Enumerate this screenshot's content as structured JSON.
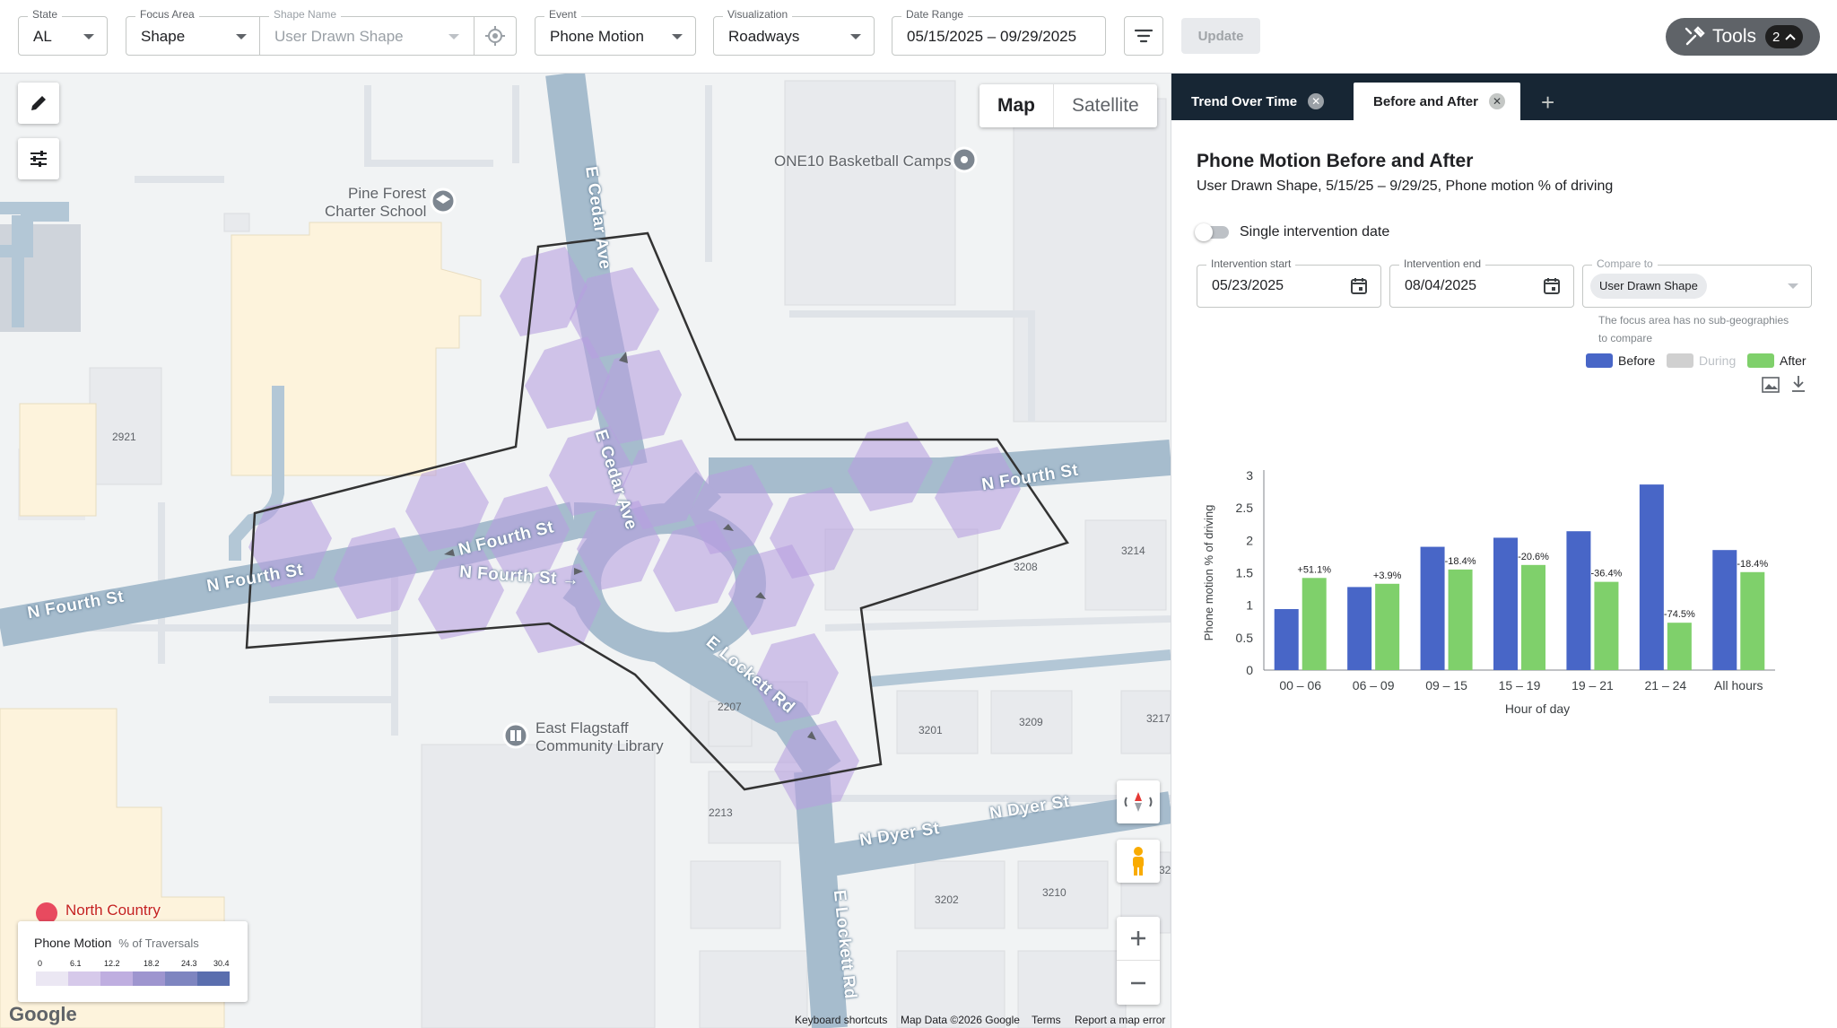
{
  "filters": {
    "state": {
      "label": "State",
      "value": "AL"
    },
    "focus_area": {
      "label": "Focus Area",
      "value": "Shape"
    },
    "shape_name": {
      "label": "Shape Name",
      "placeholder": "User Drawn Shape"
    },
    "event": {
      "label": "Event",
      "value": "Phone Motion"
    },
    "visualization": {
      "label": "Visualization",
      "value": "Roadways"
    },
    "date_range": {
      "label": "Date Range",
      "value": "05/15/2025 – 09/29/2025"
    },
    "update_label": "Update",
    "tools_label": "Tools",
    "tools_count": "2"
  },
  "map": {
    "map_type": {
      "map": "Map",
      "satellite": "Satellite"
    },
    "streets": {
      "cedar_top": "E Cedar Ave",
      "cedar_mid": "E Cedar Ave",
      "fourth_left": "N Fourth St",
      "fourth_left2": "N Fourth St",
      "fourth_ne": "N Fourth St",
      "fourth_center": "N Fourth St",
      "fourth_center2": "N Fourth St →",
      "lockett": "E Lockett Rd",
      "lockett_south": "E Lockett Rd",
      "dyer_1": "N Dyer St",
      "dyer_2": "N Dyer St"
    },
    "pois": {
      "basketball": "ONE10 Basketball Camps",
      "school_line1": "Pine Forest",
      "school_line2": "Charter School",
      "library_line1": "East Flagstaff",
      "library_line2": "Community Library",
      "north_country": "North Country"
    },
    "addresses": [
      "2921",
      "3214",
      "3208",
      "2207",
      "3201",
      "3209",
      "3217",
      "2213",
      "3202",
      "3210",
      "32"
    ],
    "legend": {
      "title": "Phone Motion",
      "unit": "% of Traversals",
      "ticks": [
        "0",
        "6.1",
        "12.2",
        "18.2",
        "24.3",
        "30.4"
      ],
      "colors": [
        "#ebe7f3",
        "#d6c9ea",
        "#bfaee0",
        "#9e95cf",
        "#7e85c0",
        "#5a6eae"
      ]
    },
    "google_logo": "Google",
    "attribution": {
      "shortcuts": "Keyboard shortcuts",
      "data": "Map Data ©2026 Google",
      "terms": "Terms",
      "report": "Report a map error"
    }
  },
  "panel": {
    "tabs": [
      {
        "label": "Trend Over Time",
        "active": false
      },
      {
        "label": "Before and After",
        "active": true
      }
    ],
    "add_tab": "+",
    "title": "Phone Motion Before and After",
    "subtitle": "User Drawn Shape, 5/15/25 – 9/29/25, Phone motion % of driving",
    "toggle_label": "Single intervention date",
    "intervention_start": {
      "label": "Intervention start",
      "value": "05/23/2025"
    },
    "intervention_end": {
      "label": "Intervention end",
      "value": "08/04/2025"
    },
    "compare_to": {
      "label": "Compare to",
      "value": "User Drawn Shape"
    },
    "note": "The focus area has no sub-geographies to compare",
    "legend": [
      {
        "label": "Before",
        "color": "#4866c7"
      },
      {
        "label": "During",
        "color": "#d0d0d0"
      },
      {
        "label": "After",
        "color": "#7fd06b"
      }
    ]
  },
  "chart_data": {
    "type": "bar",
    "categories": [
      "00 – 06",
      "06 – 09",
      "09 – 15",
      "15 – 19",
      "19 – 21",
      "21 – 24",
      "All hours"
    ],
    "series": [
      {
        "name": "Before",
        "color": "#4866c7",
        "values": [
          0.94,
          1.28,
          1.9,
          2.04,
          2.14,
          2.86,
          1.85
        ]
      },
      {
        "name": "After",
        "color": "#7fd06b",
        "values": [
          1.42,
          1.33,
          1.55,
          1.62,
          1.36,
          0.73,
          1.51
        ]
      }
    ],
    "data_labels": [
      "+51.1%",
      "+3.9%",
      "-18.4%",
      "-20.6%",
      "-36.4%",
      "-74.5%",
      "-18.4%"
    ],
    "xlabel": "Hour of day",
    "ylabel": "Phone motion % of driving",
    "ylim": [
      0,
      3
    ],
    "yticks": [
      "0",
      "0.5",
      "1",
      "1.5",
      "2",
      "2.5",
      "3"
    ],
    "grid": false,
    "legend_position": "top-right"
  }
}
